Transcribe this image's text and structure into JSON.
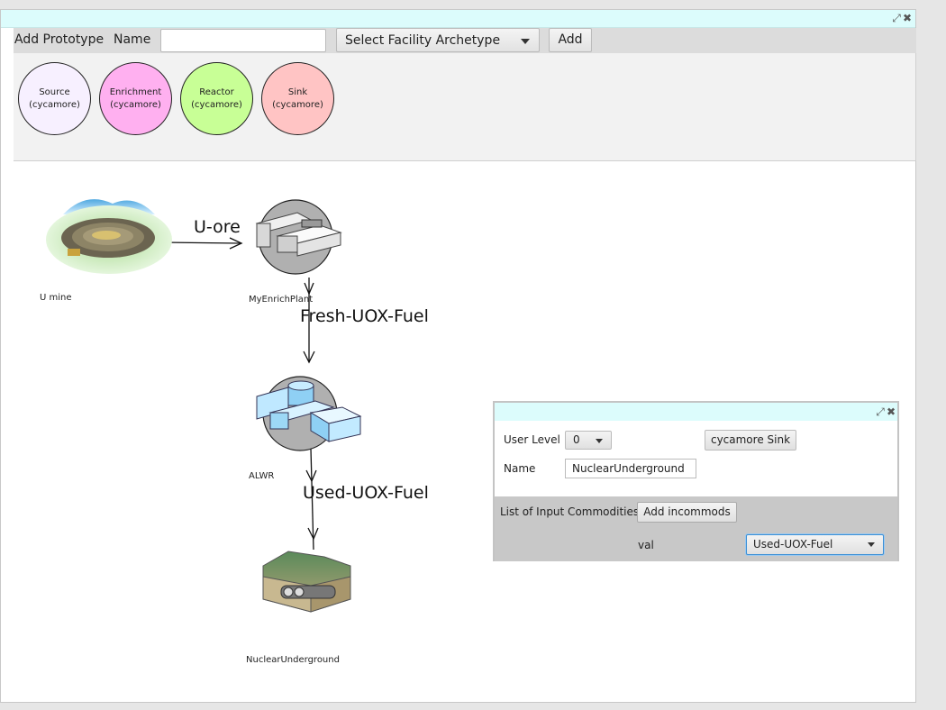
{
  "toolbar": {
    "add_prototype_label": "Add Prototype",
    "name_label": "Name",
    "name_value": "",
    "archetype_select": "Select Facility Archetype",
    "add_button": "Add"
  },
  "prototypes": [
    {
      "line1": "Source",
      "line2": "(cycamore)",
      "color": "#f7f0ff"
    },
    {
      "line1": "Enrichment",
      "line2": "(cycamore)",
      "color": "#ffb0f0"
    },
    {
      "line1": "Reactor",
      "line2": "(cycamore)",
      "color": "#c8ff96"
    },
    {
      "line1": "Sink",
      "line2": "(cycamore)",
      "color": "#ffc4c4"
    }
  ],
  "facilities": {
    "mine": "U mine",
    "enrich": "MyEnrichPlant",
    "reactor": "ALWR",
    "repository": "NuclearUnderground"
  },
  "commodities": {
    "c1": "U-ore",
    "c2": "Fresh-UOX-Fuel",
    "c3": "Used-UOX-Fuel"
  },
  "detail_panel": {
    "user_level_label": "User Level",
    "user_level_value": "0",
    "archetype_button": "cycamore Sink",
    "name_label": "Name",
    "name_value": "NuclearUnderground",
    "incommods_label": "List of Input Commodities",
    "add_incommods_button": "Add incommods",
    "val_label": "val",
    "val_value": "Used-UOX-Fuel"
  },
  "colors": {
    "titlebar": "#dcfcfc",
    "toolbar": "#dcdcdc",
    "focus": "#3a8fd6"
  }
}
